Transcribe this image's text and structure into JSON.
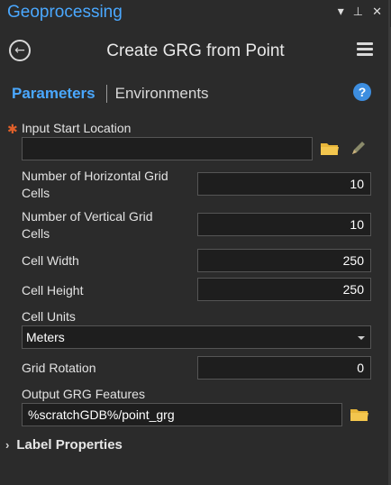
{
  "pane": {
    "title": "Geoprocessing"
  },
  "window_controls": {
    "dropdown": "▾",
    "pin": "⊥",
    "close": "✕"
  },
  "tool": {
    "title": "Create GRG from Point"
  },
  "tabs": {
    "parameters": "Parameters",
    "environments": "Environments"
  },
  "help": {
    "glyph": "?"
  },
  "params": {
    "input_start_location": {
      "label": "Input Start Location",
      "value": ""
    },
    "num_horizontal": {
      "label_line1": "Number of Horizontal Grid",
      "label_line2": "Cells",
      "value": "10"
    },
    "num_vertical": {
      "label_line1": "Number of Vertical Grid",
      "label_line2": "Cells",
      "value": "10"
    },
    "cell_width": {
      "label": "Cell Width",
      "value": "250"
    },
    "cell_height": {
      "label": "Cell Height",
      "value": "250"
    },
    "cell_units": {
      "label": "Cell Units",
      "value": "Meters"
    },
    "grid_rotation": {
      "label": "Grid Rotation",
      "value": "0"
    },
    "output_features": {
      "label": "Output GRG Features",
      "value": "%scratchGDB%/point_grg"
    }
  },
  "label_properties": {
    "label": "Label Properties"
  },
  "icons": {
    "back": "back-arrow-icon",
    "menu": "hamburger-menu-icon",
    "folder": "folder-icon",
    "pencil": "pencil-icon",
    "chevron": "chevron-right-icon"
  },
  "colors": {
    "accent": "#4aa8ff",
    "required": "#e0602a",
    "folder": "#e8b63a",
    "background": "#2b2b2b",
    "field": "#1e1e1e"
  }
}
